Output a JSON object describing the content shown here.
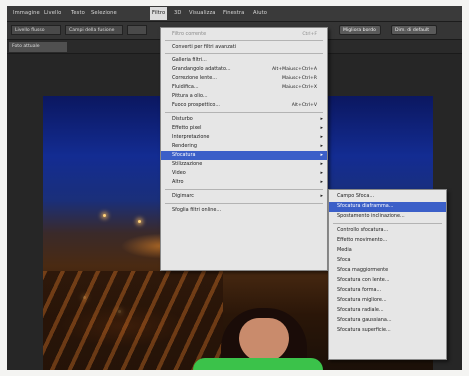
{
  "menubar": {
    "items": [
      "Immagine",
      "Livello",
      "Testo",
      "Selezione",
      "Filtro",
      "3D",
      "Visualizza",
      "Finestra",
      "Aiuto"
    ]
  },
  "options": {
    "field1": "Livello flusso",
    "field2": "Campi della fusione",
    "button1": "Migliora bordo",
    "button2": "Dim. di default"
  },
  "document": {
    "tab": "Foto attuale"
  },
  "filter_menu": {
    "items": [
      {
        "label": "Filtro corrente",
        "shortcut": "Ctrl+F",
        "disabled": true
      },
      {
        "sep": true
      },
      {
        "label": "Converti per filtri avanzati"
      },
      {
        "sep": true
      },
      {
        "label": "Galleria filtri..."
      },
      {
        "label": "Grandangolo adattato...",
        "shortcut": "Alt+Maiusc+Ctrl+A"
      },
      {
        "label": "Correzione lente...",
        "shortcut": "Maiusc+Ctrl+R"
      },
      {
        "label": "Fluidifica...",
        "shortcut": "Maiusc+Ctrl+X"
      },
      {
        "label": "Pittura a olio..."
      },
      {
        "label": "Fuoco prospettico...",
        "shortcut": "Alt+Ctrl+V"
      },
      {
        "sep": true
      },
      {
        "label": "Disturbo",
        "submenu": true
      },
      {
        "label": "Effetto pixel",
        "submenu": true
      },
      {
        "label": "Interpretazione",
        "submenu": true
      },
      {
        "label": "Rendering",
        "submenu": true
      },
      {
        "label": "Sfocatura",
        "submenu": true,
        "highlight": true
      },
      {
        "label": "Stilizzazione",
        "submenu": true
      },
      {
        "label": "Video",
        "submenu": true
      },
      {
        "label": "Altro",
        "submenu": true
      },
      {
        "sep": true
      },
      {
        "label": "Digimarc",
        "submenu": true
      },
      {
        "sep": true
      },
      {
        "label": "Sfoglia filtri online..."
      }
    ]
  },
  "blur_submenu": {
    "items": [
      {
        "label": "Campo Sfoca..."
      },
      {
        "label": "Sfocatura diaframma...",
        "highlight": true
      },
      {
        "label": "Spostamento inclinazione..."
      },
      {
        "sep": true
      },
      {
        "label": "Controllo sfocatura..."
      },
      {
        "label": "Effetto movimento..."
      },
      {
        "label": "Media"
      },
      {
        "label": "Sfoca"
      },
      {
        "label": "Sfoca maggiormente"
      },
      {
        "label": "Sfocatura con lente..."
      },
      {
        "label": "Sfocatura forma..."
      },
      {
        "label": "Sfocatura migliore..."
      },
      {
        "label": "Sfocatura radiale..."
      },
      {
        "label": "Sfocatura gaussiana..."
      },
      {
        "label": "Sfocatura superficie..."
      }
    ]
  },
  "colors": {
    "highlight": "#3b5fc8",
    "menu_bg": "#e6e6e6",
    "app_bg": "#2e2e2e"
  }
}
